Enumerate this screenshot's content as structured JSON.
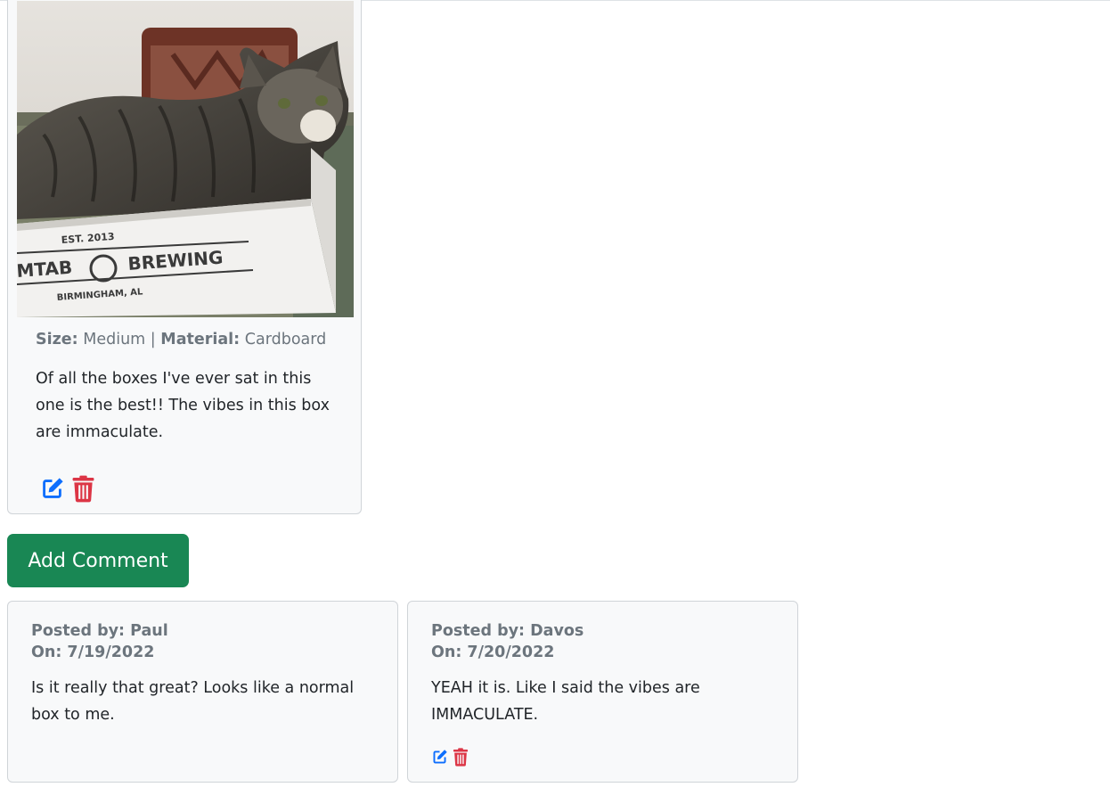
{
  "post": {
    "image_alt": "Tabby cat sitting in a cardboard box",
    "box_print": {
      "est": "EST. 2013",
      "brand_left": "MTAB",
      "brand_right": "BREWING",
      "city": "BIRMINGHAM, AL"
    },
    "size_label": "Size:",
    "size_value": "Medium",
    "separator": "|",
    "material_label": "Material:",
    "material_value": "Cardboard",
    "description": "Of all the boxes I've ever sat in this one is the best!! The vibes in this box are immaculate.",
    "icons": {
      "edit": "edit-icon",
      "delete": "trash-icon"
    }
  },
  "add_comment_label": "Add Comment",
  "comments": [
    {
      "author": "Posted by: Paul",
      "date": "On: 7/19/2022",
      "text": "Is it really that great? Looks like a normal box to me."
    },
    {
      "author": "Posted by: Davos",
      "date": "On: 7/20/2022",
      "text": "YEAH it is. Like I said the vibes are IMMACULATE."
    }
  ],
  "colors": {
    "primary": "#0d6efd",
    "danger": "#dc3545",
    "success": "#198754",
    "muted": "#6c757d",
    "card_bg": "#f8f9fa"
  }
}
